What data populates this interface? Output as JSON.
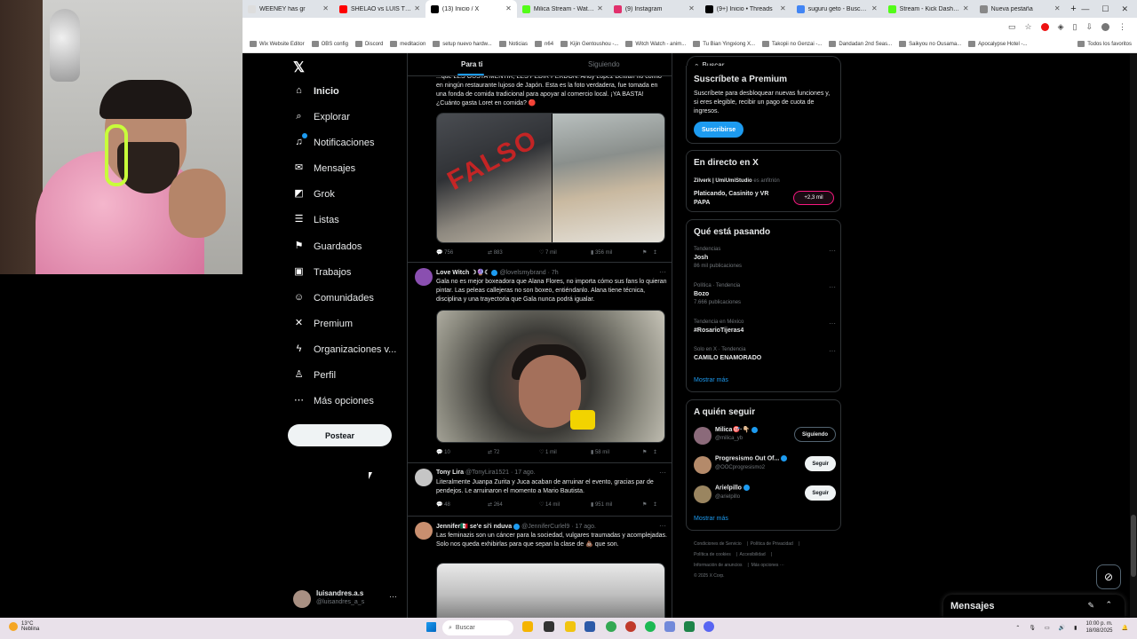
{
  "browser": {
    "tabs": [
      {
        "label": "WEENEY has gr",
        "color": "#ffffff",
        "active": false
      },
      {
        "label": "SHELAO vs LUIS THE PRO",
        "color": "#ff0000",
        "active": false
      },
      {
        "label": "(13) Inicio / X",
        "color": "#000000",
        "active": true
      },
      {
        "label": "Milica Stream - Watch Live",
        "color": "#53fc18",
        "active": false
      },
      {
        "label": "(9) Instagram",
        "color": "#e1306c",
        "active": false
      },
      {
        "label": "(9+) Inicio • Threads",
        "color": "#000000",
        "active": false
      },
      {
        "label": "suguru geto - Buscar con G",
        "color": "#4285f4",
        "active": false
      },
      {
        "label": "Stream - Kick Dashboard",
        "color": "#53fc18",
        "active": false
      },
      {
        "label": "Nueva pestaña",
        "color": "#888888",
        "active": false
      }
    ],
    "bookmarks": [
      "Wix Website Editor",
      "OBS config",
      "Discord",
      "meditacion",
      "setup nuevo hardw...",
      "Noticias",
      "n64",
      "Kijin Gentoushou -...",
      "Witch Watch - anim...",
      "Tu Bian Yingxiong X...",
      "Takopii no Genzai -...",
      "Dandadan 2nd Seas...",
      "Saikyou no Ousama...",
      "Apocalypse Hotel -..."
    ],
    "bookmarks_right": "Todos los favoritos"
  },
  "sidebar": {
    "items": [
      {
        "label": "Inicio",
        "icon": "home-icon",
        "glyph": "⌂"
      },
      {
        "label": "Explorar",
        "icon": "search-icon",
        "glyph": "⌕"
      },
      {
        "label": "Notificaciones",
        "icon": "bell-icon",
        "glyph": "♫"
      },
      {
        "label": "Mensajes",
        "icon": "mail-icon",
        "glyph": "✉"
      },
      {
        "label": "Grok",
        "icon": "grok-icon",
        "glyph": "◩"
      },
      {
        "label": "Listas",
        "icon": "list-icon",
        "glyph": "☰"
      },
      {
        "label": "Guardados",
        "icon": "bookmark-icon",
        "glyph": "⚑"
      },
      {
        "label": "Trabajos",
        "icon": "briefcase-icon",
        "glyph": "▣"
      },
      {
        "label": "Comunidades",
        "icon": "communities-icon",
        "glyph": "☺"
      },
      {
        "label": "Premium",
        "icon": "x-premium-icon",
        "glyph": "✕"
      },
      {
        "label": "Organizaciones v...",
        "icon": "lightning-icon",
        "glyph": "ϟ"
      },
      {
        "label": "Perfil",
        "icon": "profile-icon",
        "glyph": "♙"
      },
      {
        "label": "Más opciones",
        "icon": "more-icon",
        "glyph": "⋯"
      }
    ],
    "post_label": "Postear",
    "account": {
      "name": "luisandres.a.s",
      "handle": "@luisandres_a_s"
    }
  },
  "feed": {
    "tab_foryou": "Para ti",
    "tab_following": "Siguiendo",
    "tweet1": {
      "text": "...que LES GUSTA MENTIR, LES PEDIR PERDÓN. Andy López Beltrán no comió en ningún restaurante lujoso de Japón. Esta es la foto verdadera, fue tomada en una fonda de comida tradicional para apoyar al comercio local. ¡YA BASTA! ¿Cuánto gasta Loret en comida? 🔴",
      "image_text": "FALSO",
      "replies": "756",
      "reposts": "883",
      "likes": "7 mil",
      "views": "356 mil"
    },
    "tweet2": {
      "name": "Love Witch ☽🔮☾",
      "handle": "@lovelsmybrand · 7h",
      "text": "Gala no es mejor boxeadora que Alana Flores, no importa cómo sus fans lo quieran pintar. Las peleas callejeras no son boxeo, entiéndanlo. Alana tiene técnica, disciplina y una trayectoria que Gala nunca podrá igualar.",
      "replies": "10",
      "reposts": "72",
      "likes": "1 mil",
      "views": "58 mil"
    },
    "tweet3": {
      "name": "Tony Lira",
      "handle": "@TonyLira1521 · 17 ago.",
      "text": "Literalmente Juanpa Zurita y Juca acaban de arruinar el evento, gracias par de pendejos. Le arruinaron el momento a Mario Bautista.",
      "replies": "48",
      "reposts": "264",
      "likes": "14 mil",
      "views": "951 mil"
    },
    "tweet4": {
      "name": "Jennifer🇲🇽 se'e si'i nduva",
      "handle": "@JenniferCurlel9 · 17 ago.",
      "text": "Las feminazis son un cáncer para la sociedad, vulgares traumadas y acomplejadas. Solo nos queda exhibirlas para que sepan la clase de 💩 que son."
    }
  },
  "right": {
    "search_placeholder": "Buscar",
    "premium": {
      "title": "Suscríbete a Premium",
      "text": "Suscríbete para desbloquear nuevas funciones y, si eres elegible, recibir un pago de cuota de ingresos.",
      "button": "Suscribirse"
    },
    "live": {
      "title": "En directo en X",
      "host": "Zilverk | UmiUmiStudio",
      "host_suffix": "es anfitrión",
      "stream_title": "Platicando, Casinito y VR PAPA",
      "viewers": "+2,3 mil"
    },
    "trends": {
      "title": "Qué está pasando",
      "items": [
        {
          "context": "Tendencias",
          "topic": "Josh",
          "count": "86 mil publicaciones"
        },
        {
          "context": "Política · Tendencia",
          "topic": "Bozo",
          "count": "7.666 publicaciones"
        },
        {
          "context": "Tendencia en México",
          "topic": "#RosarioTijeras4",
          "count": ""
        },
        {
          "context": "Solo en X · Tendencia",
          "topic": "CAMILO ENAMORADO",
          "count": ""
        }
      ],
      "more": "Mostrar más"
    },
    "follow": {
      "title": "A quién seguir",
      "items": [
        {
          "name": "Milica🎯·👇🏼",
          "handle": "@milica_yb",
          "button": "Siguiendo",
          "color": "#8b6a7a"
        },
        {
          "name": "Progresismo Out Of...",
          "handle": "@OOCprogresismo2",
          "button": "Seguir",
          "color": "#b48a6a"
        },
        {
          "name": "Arielpillo",
          "handle": "@arielpillo",
          "button": "Seguir",
          "color": "#9a8560"
        }
      ],
      "more": "Mostrar más"
    },
    "footer": [
      "Condiciones de Servicio",
      "Política de Privacidad",
      "Política de cookies",
      "Accesibilidad",
      "Información de anuncios",
      "Más opciones ···",
      "© 2025 X Corp."
    ]
  },
  "messages_dock": {
    "title": "Mensajes"
  },
  "taskbar": {
    "temp": "13°C",
    "weather": "Neblina",
    "search": "Buscar",
    "time": "10:00 p. m.",
    "date": "18/08/2025"
  }
}
